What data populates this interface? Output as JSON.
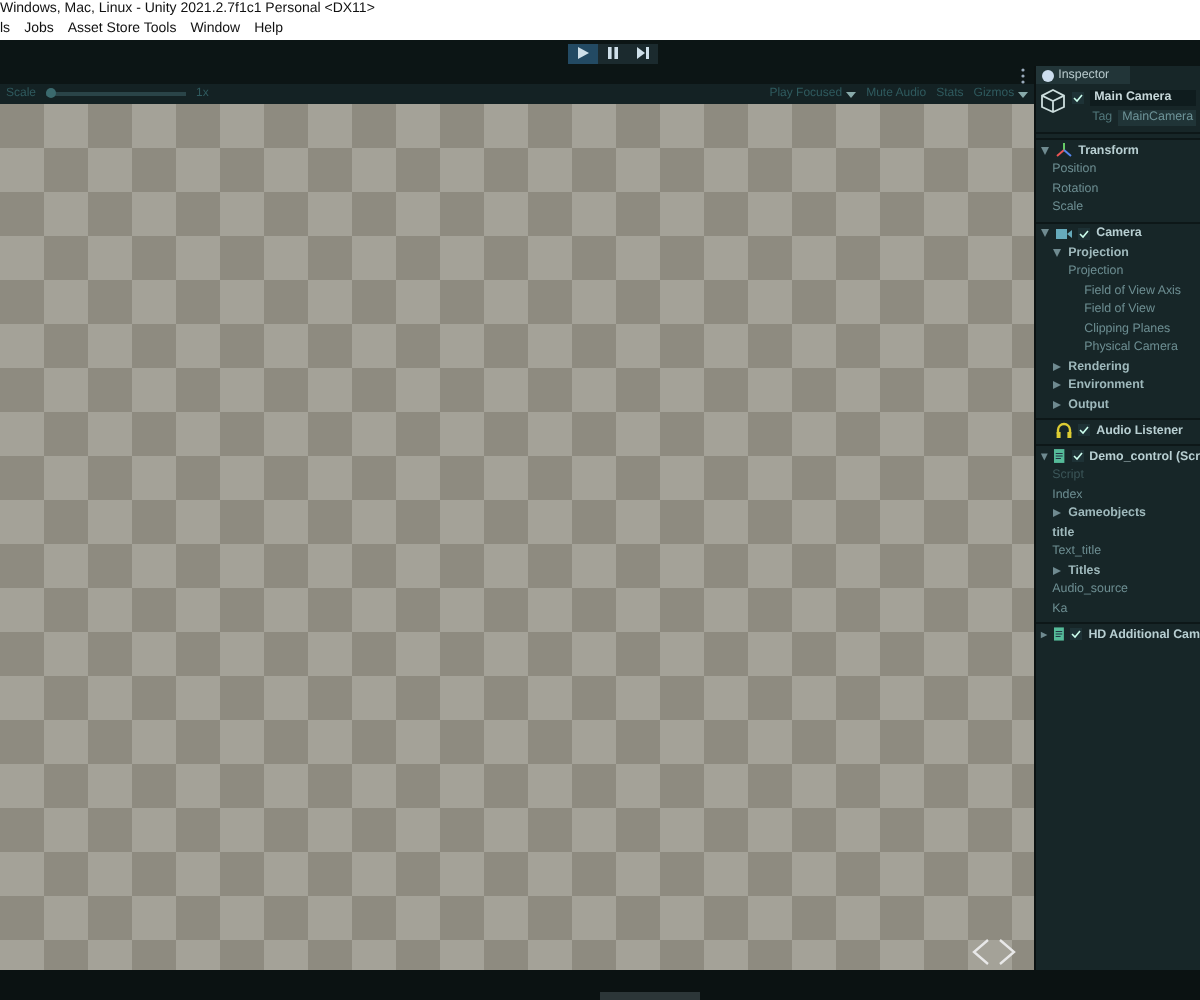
{
  "window": {
    "title": "Windows, Mac, Linux - Unity 2021.2.7f1c1 Personal <DX11>"
  },
  "menu": [
    "ls",
    "Jobs",
    "Asset Store Tools",
    "Window",
    "Help"
  ],
  "playbar": [
    {
      "kind": "play",
      "selected": true
    },
    {
      "kind": "pause",
      "selected": false
    },
    {
      "kind": "step",
      "selected": false
    }
  ],
  "game_toolbar": {
    "scale_label": "Scale",
    "scale": {
      "level": 0.03
    },
    "scale_value": "1x",
    "play_mode": "Play Focused",
    "mute": "Mute Audio",
    "stats": "Stats",
    "gizmos": "Gizmos"
  },
  "inspector": {
    "tab": "Inspector",
    "object": {
      "name": "Main Camera",
      "active": true,
      "tag_label": "Tag",
      "tag": "MainCamera"
    },
    "components": [
      {
        "title": "Transform",
        "kind": "transform",
        "expanded": true,
        "rows": [
          {
            "kind": "field",
            "label": "Position"
          },
          {
            "kind": "field",
            "label": "Rotation"
          },
          {
            "kind": "field",
            "label": "Scale"
          }
        ]
      },
      {
        "title": "Camera",
        "kind": "camera",
        "checked": true,
        "expanded": true,
        "rows": [
          {
            "kind": "foldout",
            "label": "Projection",
            "expanded": true,
            "children": [
              {
                "kind": "field",
                "label": "Projection",
                "children": [
                  {
                    "kind": "field",
                    "label": "Field of View Axis"
                  },
                  {
                    "kind": "field",
                    "label": "Field of View"
                  },
                  {
                    "kind": "field",
                    "label": "Clipping Planes"
                  },
                  {
                    "kind": "field",
                    "label": "Physical Camera"
                  }
                ]
              }
            ]
          },
          {
            "kind": "foldout",
            "label": "Rendering",
            "expanded": false
          },
          {
            "kind": "foldout",
            "label": "Environment",
            "expanded": false
          },
          {
            "kind": "foldout",
            "label": "Output",
            "expanded": false
          }
        ]
      },
      {
        "title": "Audio Listener",
        "kind": "audio",
        "checked": true
      },
      {
        "title": "Demo_control (Scr",
        "kind": "script",
        "checked": true,
        "expanded": true,
        "rows": [
          {
            "kind": "field",
            "label": "Script",
            "disabled": true
          },
          {
            "kind": "field",
            "label": "Index"
          },
          {
            "kind": "foldout",
            "label": "Gameobjects",
            "expanded": false
          },
          {
            "kind": "header",
            "label": "title"
          },
          {
            "kind": "field",
            "label": "Text_title"
          },
          {
            "kind": "foldout",
            "label": "Titles",
            "expanded": false
          },
          {
            "kind": "field",
            "label": "Audio_source"
          },
          {
            "kind": "field",
            "label": "Ka"
          }
        ]
      },
      {
        "title": "HD Additional Cam",
        "kind": "script",
        "checked": true,
        "expanded": false
      }
    ]
  }
}
